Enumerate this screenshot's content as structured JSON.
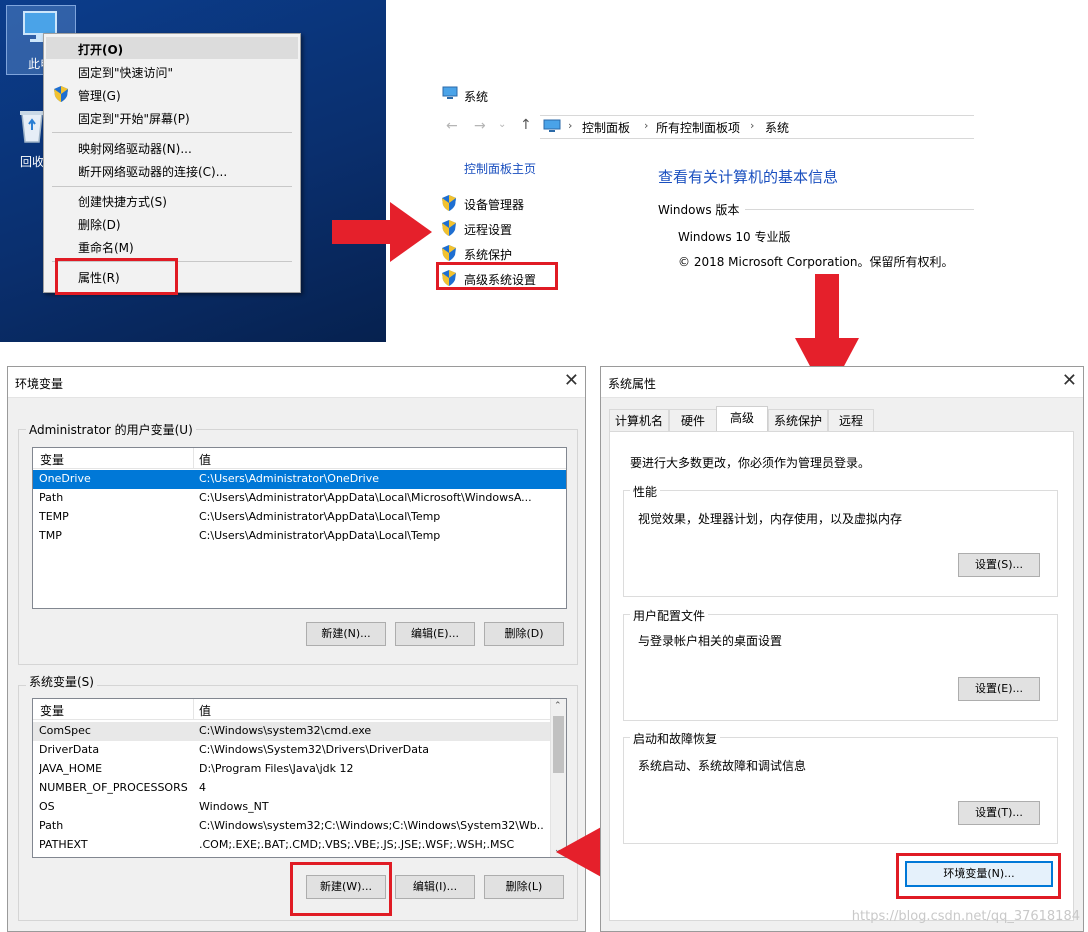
{
  "desktop": {
    "icons": [
      {
        "label": "此电"
      },
      {
        "label": "回收"
      }
    ]
  },
  "context_menu": {
    "items": [
      {
        "label": "打开(O)"
      },
      {
        "label": "固定到\"快速访问\""
      },
      {
        "label": "管理(G)"
      },
      {
        "label": "固定到\"开始\"屏幕(P)"
      },
      {
        "label": "映射网络驱动器(N)..."
      },
      {
        "label": "断开网络驱动器的连接(C)..."
      },
      {
        "label": "创建快捷方式(S)"
      },
      {
        "label": "删除(D)"
      },
      {
        "label": "重命名(M)"
      },
      {
        "label": "属性(R)"
      }
    ]
  },
  "system_window": {
    "title": "系统",
    "breadcrumb": [
      "控制面板",
      "所有控制面板项",
      "系统"
    ],
    "sidebar_home": "控制面板主页",
    "links": [
      {
        "label": "设备管理器"
      },
      {
        "label": "远程设置"
      },
      {
        "label": "系统保护"
      },
      {
        "label": "高级系统设置"
      }
    ],
    "heading": "查看有关计算机的基本信息",
    "edition_section": "Windows 版本",
    "edition": "Windows 10 专业版",
    "copyright": "© 2018 Microsoft Corporation。保留所有权利。"
  },
  "env_dialog": {
    "title": "环境变量",
    "user_group": "Administrator 的用户变量(U)",
    "col_var": "变量",
    "col_val": "值",
    "user_rows": [
      {
        "name": "OneDrive",
        "value": "C:\\Users\\Administrator\\OneDrive"
      },
      {
        "name": "Path",
        "value": "C:\\Users\\Administrator\\AppData\\Local\\Microsoft\\WindowsA..."
      },
      {
        "name": "TEMP",
        "value": "C:\\Users\\Administrator\\AppData\\Local\\Temp"
      },
      {
        "name": "TMP",
        "value": "C:\\Users\\Administrator\\AppData\\Local\\Temp"
      }
    ],
    "user_buttons": {
      "new": "新建(N)...",
      "edit": "编辑(E)...",
      "delete": "删除(D)"
    },
    "sys_group": "系统变量(S)",
    "sys_rows": [
      {
        "name": "ComSpec",
        "value": "C:\\Windows\\system32\\cmd.exe"
      },
      {
        "name": "DriverData",
        "value": "C:\\Windows\\System32\\Drivers\\DriverData"
      },
      {
        "name": "JAVA_HOME",
        "value": "D:\\Program Files\\Java\\jdk 12"
      },
      {
        "name": "NUMBER_OF_PROCESSORS",
        "value": "4"
      },
      {
        "name": "OS",
        "value": "Windows_NT"
      },
      {
        "name": "Path",
        "value": "C:\\Windows\\system32;C:\\Windows;C:\\Windows\\System32\\Wb..."
      },
      {
        "name": "PATHEXT",
        "value": ".COM;.EXE;.BAT;.CMD;.VBS;.VBE;.JS;.JSE;.WSF;.WSH;.MSC"
      }
    ],
    "sys_buttons": {
      "new": "新建(W)...",
      "edit": "编辑(I)...",
      "delete": "删除(L)"
    }
  },
  "sysprop_dialog": {
    "title": "系统属性",
    "tabs": [
      {
        "label": "计算机名"
      },
      {
        "label": "硬件"
      },
      {
        "label": "高级"
      },
      {
        "label": "系统保护"
      },
      {
        "label": "远程"
      }
    ],
    "admin_note": "要进行大多数更改，你必须作为管理员登录。",
    "perf_title": "性能",
    "perf_desc": "视觉效果，处理器计划，内存使用，以及虚拟内存",
    "perf_btn": "设置(S)...",
    "profile_title": "用户配置文件",
    "profile_desc": "与登录帐户相关的桌面设置",
    "profile_btn": "设置(E)...",
    "startup_title": "启动和故障恢复",
    "startup_desc": "系统启动、系统故障和调试信息",
    "startup_btn": "设置(T)...",
    "env_btn": "环境变量(N)..."
  },
  "watermark": "https://blog.csdn.net/qq_37618184",
  "colors": {
    "highlight_box": "#e01b24",
    "arrow": "#e5202b",
    "selection": "#0078d7",
    "link": "#1a4fbf"
  }
}
